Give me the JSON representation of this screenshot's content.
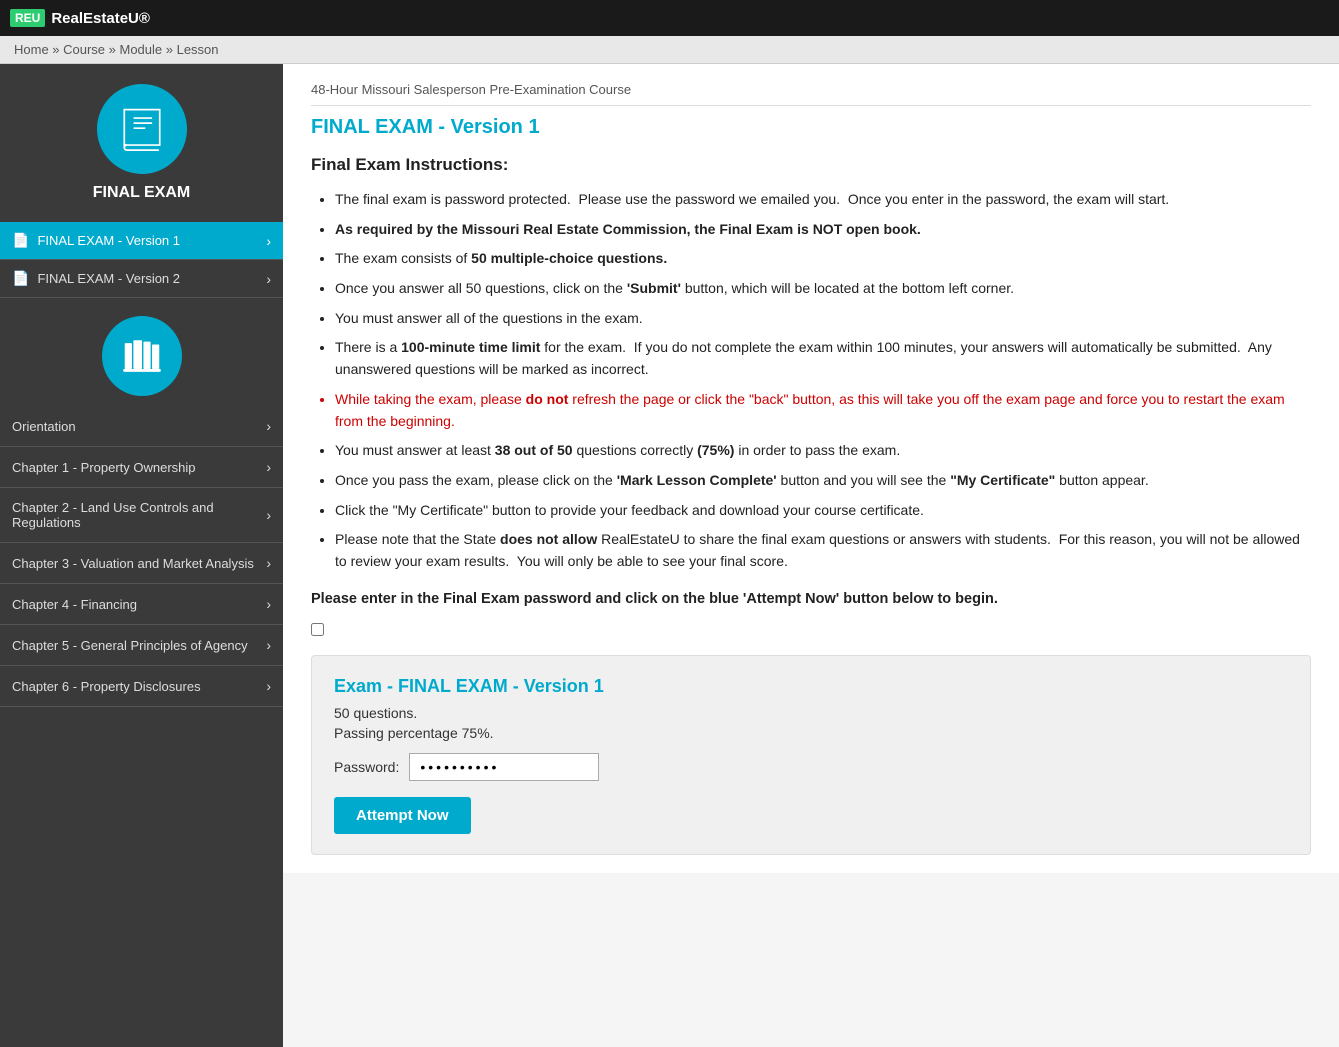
{
  "topbar": {
    "logo_badge": "REU",
    "logo_text": "RealEstateU®"
  },
  "breadcrumb": {
    "text": "Home » Course » Module » Lesson"
  },
  "sidebar": {
    "exam_icon_label": "FINAL EXAM",
    "exam_items": [
      {
        "label": "FINAL EXAM - Version 1",
        "active": true
      },
      {
        "label": "FINAL EXAM - Version 2",
        "active": false
      }
    ],
    "chapters": [
      {
        "label": "Orientation"
      },
      {
        "label": "Chapter 1 - Property Ownership"
      },
      {
        "label": "Chapter 2 - Land Use Controls and Regulations"
      },
      {
        "label": "Chapter 3 - Valuation and Market Analysis"
      },
      {
        "label": "Chapter 4 - Financing"
      },
      {
        "label": "Chapter 5 - General Principles of Agency"
      },
      {
        "label": "Chapter 6 - Property Disclosures"
      }
    ]
  },
  "content": {
    "course_subtitle": "48-Hour Missouri Salesperson Pre-Examination Course",
    "exam_title": "FINAL EXAM - Version 1",
    "instructions_heading": "Final Exam Instructions:",
    "instructions": [
      {
        "text": "The final exam is password protected.  Please use the password we emailed you.  Once you enter in the password, the exam will start.",
        "bold_parts": [],
        "red": false
      },
      {
        "text": "As required by the Missouri Real Estate Commission, the Final Exam is NOT open book.",
        "bold": true,
        "red": false
      },
      {
        "text": "The exam consists of 50 multiple-choice questions.",
        "bold_parts": [
          "50 multiple-choice questions."
        ],
        "red": false
      },
      {
        "text": "Once you answer all 50 questions, click on the 'Submit' button, which will be located at the bottom left corner.",
        "bold_parts": [
          "'Submit'"
        ],
        "red": false
      },
      {
        "text": "You must answer all of the questions in the exam.",
        "bold_parts": [],
        "red": false
      },
      {
        "text": "There is a 100-minute time limit for the exam.  If you do not complete the exam within 100 minutes, your answers will automatically be submitted.  Any unanswered questions will be marked as incorrect.",
        "bold_parts": [
          "100-minute time limit"
        ],
        "red": false
      },
      {
        "text": "While taking the exam, please do not refresh the page or click the \"back\" button, as this will take you off the exam page and force you to restart the exam from the beginning.",
        "red": true
      },
      {
        "text": "You must answer at least 38 out of 50 questions correctly (75%) in order to pass the exam.",
        "bold_parts": [
          "38 out of 50",
          "(75%)"
        ],
        "red": false
      },
      {
        "text": "Once you pass the exam, please click on the 'Mark Lesson Complete' button and you will see the \"My Certificate\" button appear.",
        "bold_parts": [
          "'Mark Lesson Complete'",
          "\"My Certificate\""
        ],
        "red": false
      },
      {
        "text": "Click the \"My Certificate\" button to provide your feedback and download your course certificate.",
        "red": false
      },
      {
        "text": "Please note that the State does not allow RealEstateU to share the final exam questions or answers with students.  For this reason, you will not be allowed to review your exam results.  You will only be able to see your final score.",
        "bold_parts": [
          "does not allow"
        ],
        "red": false
      }
    ],
    "password_instruction": "Please enter in the Final Exam password and click on the blue 'Attempt Now' button below to begin.",
    "exam_box": {
      "title": "Exam - FINAL EXAM - Version 1",
      "questions_info": "50 questions.",
      "passing_info": "Passing percentage 75%.",
      "password_label": "Password:",
      "password_value": "••••••••••",
      "attempt_button": "Attempt Now"
    }
  }
}
